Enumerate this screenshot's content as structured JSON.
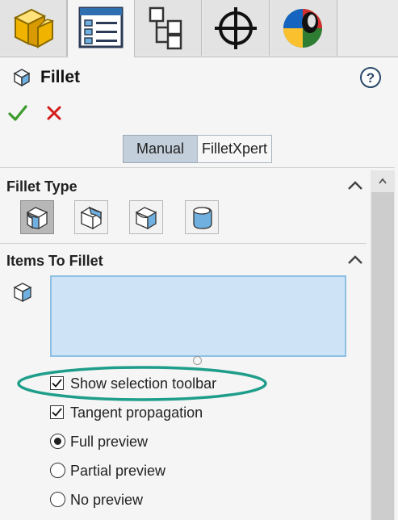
{
  "header": {
    "title": "Fillet"
  },
  "mode_tabs": {
    "manual": "Manual",
    "filletxpert": "FilletXpert"
  },
  "sections": {
    "fillet_type": {
      "title": "Fillet Type"
    },
    "items_to_fillet": {
      "title": "Items To Fillet"
    }
  },
  "options": {
    "show_selection_toolbar": {
      "label": "Show selection toolbar",
      "checked": true
    },
    "tangent_propagation": {
      "label": "Tangent propagation",
      "checked": true
    },
    "full_preview": {
      "label": "Full preview",
      "selected": true
    },
    "partial_preview": {
      "label": "Partial preview",
      "selected": false
    },
    "no_preview": {
      "label": "No preview",
      "selected": false
    }
  },
  "colors": {
    "accent_teal": "#1e9e8a",
    "ok_green": "#3a9a2a",
    "cancel_red": "#d21a1a",
    "selection_fill": "#cfe3f6"
  },
  "icons": [
    "part-icon",
    "property-manager-icon",
    "configuration-manager-icon",
    "dimxpert-icon",
    "display-manager-icon",
    "fillet-feature-icon",
    "help-icon",
    "ok-check-icon",
    "cancel-x-icon",
    "chevron-up-icon",
    "edge-face-selection-icon"
  ]
}
